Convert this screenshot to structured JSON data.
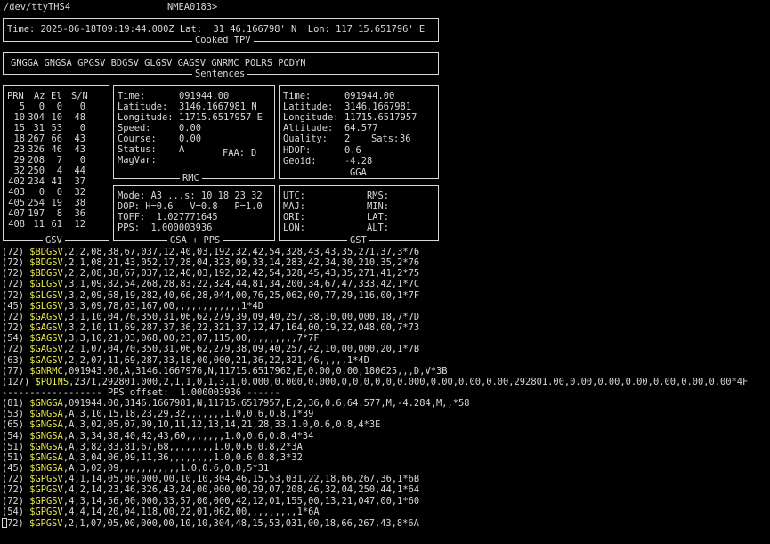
{
  "header": {
    "device": "/dev/ttyTHS4",
    "protocol": "NMEA0183>"
  },
  "tpv": {
    "line": "Time: 2025-06-18T09:19:44.000Z Lat:  31 46.166798' N  Lon: 117 15.651796' E",
    "title": "Cooked TPV"
  },
  "sentences": {
    "line": "GNGGA GNGSA GPGSV BDGSV GLGSV GAGSV GNRMC POLRS PODYN",
    "title": "Sentences"
  },
  "gsv": {
    "title": "GSV",
    "headers": [
      "PRN",
      "Az",
      "El",
      "S/N"
    ],
    "rows": [
      [
        "5",
        "0",
        "0",
        "0"
      ],
      [
        "10",
        "304",
        "10",
        "48"
      ],
      [
        "15",
        "31",
        "53",
        "0"
      ],
      [
        "18",
        "267",
        "66",
        "43"
      ],
      [
        "23",
        "326",
        "46",
        "43"
      ],
      [
        "29",
        "208",
        "7",
        "0"
      ],
      [
        "32",
        "250",
        "4",
        "44"
      ],
      [
        "402",
        "234",
        "41",
        "37"
      ],
      [
        "403",
        "0",
        "0",
        "32"
      ],
      [
        "405",
        "254",
        "19",
        "38"
      ],
      [
        "407",
        "197",
        "8",
        "36"
      ],
      [
        "408",
        "11",
        "61",
        "12"
      ]
    ]
  },
  "rmc": {
    "title": "RMC",
    "rows": [
      [
        "Time:",
        "091944.00"
      ],
      [
        "Latitude:",
        "3146.1667981 N"
      ],
      [
        "Longitude:",
        "11715.6517957 E"
      ],
      [
        "Speed:",
        "0.00"
      ],
      [
        "Course:",
        "0.00"
      ],
      [
        "Status:",
        "A"
      ],
      [
        "MagVar:",
        ""
      ]
    ],
    "faa_label": "FAA:",
    "faa_value": "D"
  },
  "gga": {
    "title": "GGA",
    "time_label": "Time:",
    "time_value": "091944.00",
    "lat_label": "Latitude:",
    "lat_value": "3146.1667981",
    "lon_label": "Longitude:",
    "lon_value": "11715.6517957",
    "alt_label": "Altitude:",
    "alt_value": "64.577",
    "quality_label": "Quality:",
    "quality_value": "2",
    "sats_label": "Sats:",
    "sats_value": "36",
    "hdop_label": "HDOP:",
    "hdop_value": "0.6",
    "geoid_label": "Geoid:",
    "geoid_sign": "-4",
    "geoid_rest": ".28"
  },
  "gsa": {
    "title": "GSA + PPS",
    "lines": [
      "Mode: A3 ...s: 10 18 23 32",
      "DOP: H=0.6   V=0.8   P=1.0",
      "TOFF:  1.027771645",
      "PPS:  1.000003936"
    ]
  },
  "gst": {
    "title": "GST",
    "left": [
      "UTC:",
      "MAJ:",
      "ORI:",
      "LON:"
    ],
    "right": [
      "RMS:",
      "MIN:",
      "LAT:",
      "ALT:"
    ]
  },
  "log": [
    {
      "p": "(72) ",
      "s": "$BDGSV",
      "r": ",2,2,08,38,67,037,12,40,03,192,32,42,54,328,43,43,35,271,37,3*76"
    },
    {
      "p": "(72) ",
      "s": "$BDGSV",
      "r": ",2,1,08,21,43,052,17,28,04,323,09,33,14,283,42,34,30,210,35,2*76"
    },
    {
      "p": "(72) ",
      "s": "$BDGSV",
      "r": ",2,2,08,38,67,037,12,40,03,192,32,42,54,328,45,43,35,271,41,2*75"
    },
    {
      "p": "(72) ",
      "s": "$GLGSV",
      "r": ",3,1,09,82,54,268,28,83,22,324,44,81,34,200,34,67,47,333,42,1*7C"
    },
    {
      "p": "(72) ",
      "s": "$GLGSV",
      "r": ",3,2,09,68,19,282,40,66,28,044,00,76,25,062,00,77,29,116,00,1*7F"
    },
    {
      "p": "(45) ",
      "s": "$GLGSV",
      "r": ",3,3,09,78,03,167,00,,,,,,,,,,,,1*4D"
    },
    {
      "p": "(72) ",
      "s": "$GAGSV",
      "r": ",3,1,10,04,70,350,31,06,62,279,39,09,40,257,38,10,00,000,18,7*7D"
    },
    {
      "p": "(72) ",
      "s": "$GAGSV",
      "r": ",3,2,10,11,69,287,37,36,22,321,37,12,47,164,00,19,22,048,00,7*73"
    },
    {
      "p": "(54) ",
      "s": "$GAGSV",
      "r": ",3,3,10,21,03,068,00,23,07,115,00,,,,,,,,,7*7F"
    },
    {
      "p": "(72) ",
      "s": "$GAGSV",
      "r": ",2,1,07,04,70,350,31,06,62,279,38,09,40,257,42,10,00,000,20,1*7B"
    },
    {
      "p": "(63) ",
      "s": "$GAGSV",
      "r": ",2,2,07,11,69,287,33,18,00,000,21,36,22,321,46,,,,,1*4D"
    },
    {
      "p": "(77) ",
      "s": "$GNRMC",
      "r": ",091943.00,A,3146.1667976,N,11715.6517962,E,0.00,0.00,180625,,,D,V*3B"
    },
    {
      "p": "(127) ",
      "s": "$POINS",
      "r": ",2371,292801.000,2,1,1,0,1,3,1,0.000,0.000,0.000,0,0,0,0,0,0.000,0.00,0.00,0.00,292801.00,0.00,0.00,0.00,0.00,0.00,0.00*4F"
    },
    {
      "pps": true,
      "dash": "------------------",
      "label": " PPS offset:  1.000003936 ",
      "dash2": "------"
    },
    {
      "p": "(81) ",
      "s": "$GNGGA",
      "r": ",091944.00,3146.1667981,N,11715.6517957,E,2,36,0.6,64.577,M,-4.284,M,,*58"
    },
    {
      "p": "(53) ",
      "s": "$GNGSA",
      "r": ",A,3,10,15,18,23,29,32,,,,,,,1.0,0.6,0.8,1*39"
    },
    {
      "p": "(65) ",
      "s": "$GNGSA",
      "r": ",A,3,02,05,07,09,10,11,12,13,14,21,28,33,1.0,0.6,0.8,4*3E"
    },
    {
      "p": "(54) ",
      "s": "$GNGSA",
      "r": ",A,3,34,38,40,42,43,60,,,,,,,1.0,0.6,0.8,4*34"
    },
    {
      "p": "(51) ",
      "s": "$GNGSA",
      "r": ",A,3,82,83,81,67,68,,,,,,,,1.0,0.6,0.8,2*3A"
    },
    {
      "p": "(51) ",
      "s": "$GNGSA",
      "r": ",A,3,04,06,09,11,36,,,,,,,,1.0,0.6,0.8,3*32"
    },
    {
      "p": "(45) ",
      "s": "$GNGSA",
      "r": ",A,3,02,09,,,,,,,,,,,1.0,0.6,0.8,5*31"
    },
    {
      "p": "(72) ",
      "s": "$GPGSV",
      "r": ",4,1,14,05,00,000,00,10,10,304,46,15,53,031,22,18,66,267,36,1*6B"
    },
    {
      "p": "(72) ",
      "s": "$GPGSV",
      "r": ",4,2,14,23,46,326,43,24,00,000,00,29,07,208,46,32,04,250,44,1*64"
    },
    {
      "p": "(72) ",
      "s": "$GPGSV",
      "r": ",4,3,14,56,00,000,33,57,00,000,42,12,01,155,00,13,21,047,00,1*60"
    },
    {
      "p": "(54) ",
      "s": "$GPGSV",
      "r": ",4,4,14,20,04,118,00,22,01,062,00,,,,,,,,,1*6A"
    },
    {
      "p": "72) ",
      "s": "$GPGSV",
      "r": ",2,1,07,05,00,000,00,10,10,304,48,15,53,031,00,18,66,267,43,8*6A",
      "cursor": true
    }
  ]
}
